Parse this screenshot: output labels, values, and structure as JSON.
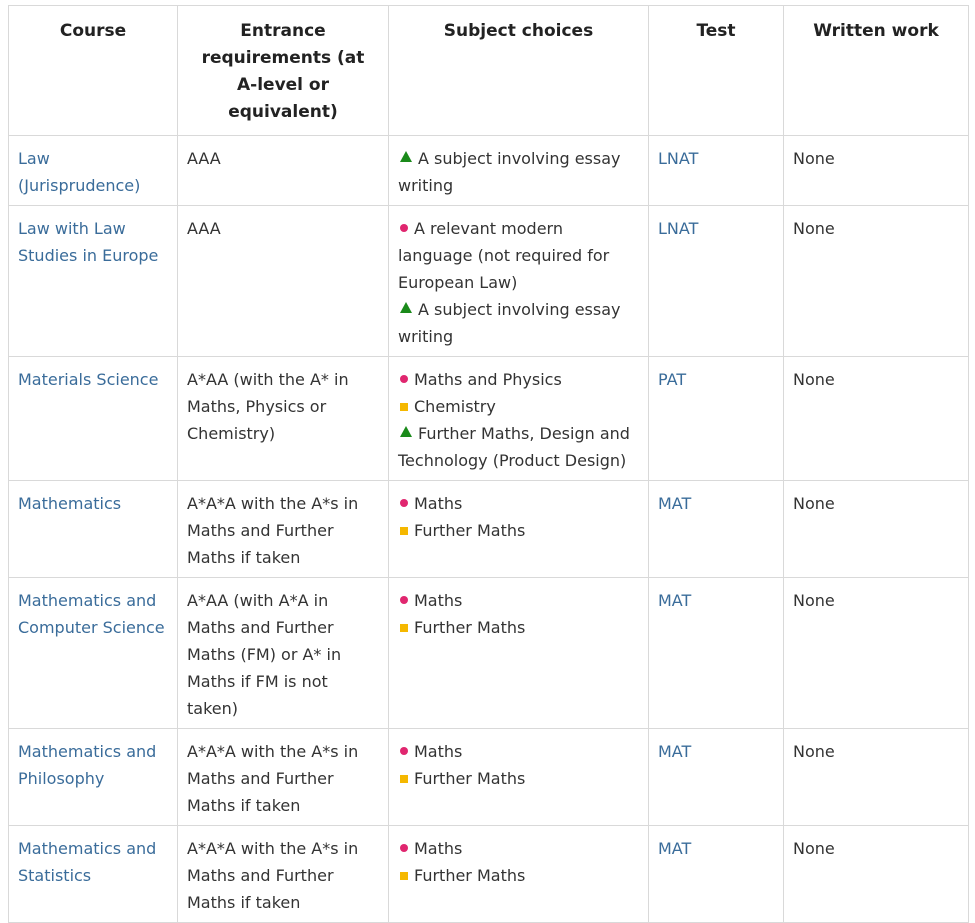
{
  "headers": [
    "Course",
    "Entrance requirements (at A-level or equivalent)",
    "Subject choices",
    "Test",
    "Written work"
  ],
  "marker_colors": {
    "circle": "#e0266f",
    "square": "#f5b800",
    "triangle": "#1a8a1a"
  },
  "rows": [
    {
      "course": "Law (Jurisprudence)",
      "entrance": "AAA",
      "subjects": [
        {
          "marker": "triangle",
          "text": "A subject involving essay writing"
        }
      ],
      "test": "LNAT",
      "written": "None"
    },
    {
      "course": "Law with Law Studies in Europe",
      "entrance": "AAA",
      "subjects": [
        {
          "marker": "circle",
          "text": "A relevant modern language (not required for European Law)"
        },
        {
          "marker": "triangle",
          "text": "A subject involving essay writing"
        }
      ],
      "test": "LNAT",
      "written": "None"
    },
    {
      "course": "Materials Science",
      "entrance": "A*AA (with the A* in Maths, Physics or Chemistry)",
      "subjects": [
        {
          "marker": "circle",
          "text": "Maths and Physics"
        },
        {
          "marker": "square",
          "text": "Chemistry"
        },
        {
          "marker": "triangle",
          "text": "Further Maths, Design and Technology (Product Design)"
        }
      ],
      "test": "PAT",
      "written": "None"
    },
    {
      "course": "Mathematics",
      "entrance": "A*A*A with the A*s in Maths and Further Maths if taken",
      "subjects": [
        {
          "marker": "circle",
          "text": "Maths"
        },
        {
          "marker": "square",
          "text": "Further Maths"
        }
      ],
      "test": "MAT",
      "written": "None"
    },
    {
      "course": "Mathematics and Computer Science",
      "entrance": "A*AA (with A*A in Maths and Further Maths (FM) or A* in Maths if FM is not taken)",
      "subjects": [
        {
          "marker": "circle",
          "text": "Maths"
        },
        {
          "marker": "square",
          "text": "Further Maths"
        }
      ],
      "test": "MAT",
      "written": "None"
    },
    {
      "course": "Mathematics and Philosophy",
      "entrance": "A*A*A with the A*s in Maths and Further Maths if taken",
      "subjects": [
        {
          "marker": "circle",
          "text": "Maths"
        },
        {
          "marker": "square",
          "text": "Further Maths"
        }
      ],
      "test": "MAT",
      "written": "None"
    },
    {
      "course": "Mathematics and Statistics",
      "entrance": "A*A*A with the A*s in Maths and Further Maths if taken",
      "subjects": [
        {
          "marker": "circle",
          "text": "Maths"
        },
        {
          "marker": "square",
          "text": "Further Maths"
        }
      ],
      "test": "MAT",
      "written": "None"
    }
  ]
}
